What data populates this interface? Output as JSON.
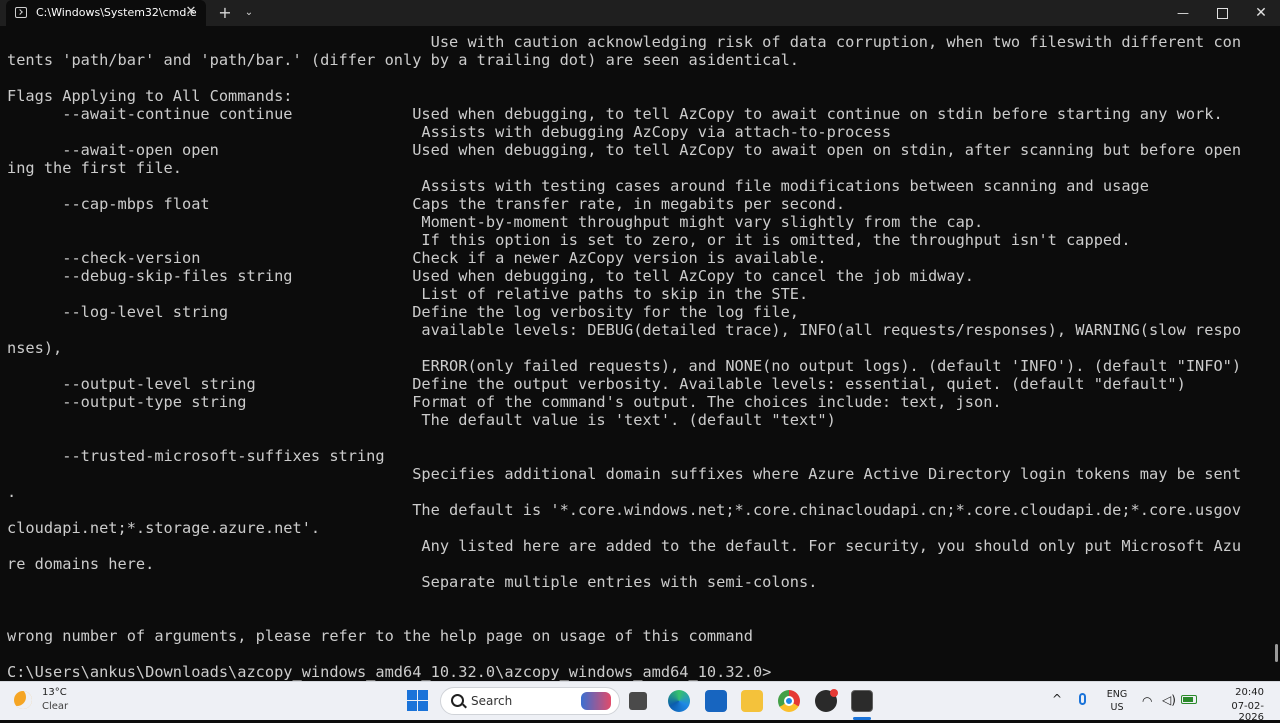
{
  "window": {
    "tab_title": "C:\\Windows\\System32\\cmd.e",
    "tab_close_glyph": "✕",
    "new_tab_glyph": "+",
    "dropdown_glyph": "⌄",
    "minimize_glyph": "—",
    "close_glyph": "✕"
  },
  "console": {
    "text": "                                              Use with caution acknowledging risk of data corruption, when two fileswith different con\ntents 'path/bar' and 'path/bar.' (differ only by a trailing dot) are seen asidentical.\n\nFlags Applying to All Commands:\n      --await-continue continue             Used when debugging, to tell AzCopy to await continue on stdin before starting any work.\n                                             Assists with debugging AzCopy via attach-to-process\n      --await-open open                     Used when debugging, to tell AzCopy to await open on stdin, after scanning but before open\ning the first file.\n                                             Assists with testing cases around file modifications between scanning and usage\n      --cap-mbps float                      Caps the transfer rate, in megabits per second.\n                                             Moment-by-moment throughput might vary slightly from the cap.\n                                             If this option is set to zero, or it is omitted, the throughput isn't capped.\n      --check-version                       Check if a newer AzCopy version is available.\n      --debug-skip-files string             Used when debugging, to tell AzCopy to cancel the job midway.\n                                             List of relative paths to skip in the STE.\n      --log-level string                    Define the log verbosity for the log file,\n                                             available levels: DEBUG(detailed trace), INFO(all requests/responses), WARNING(slow respo\nnses),\n                                             ERROR(only failed requests), and NONE(no output logs). (default 'INFO'). (default \"INFO\")\n      --output-level string                 Define the output verbosity. Available levels: essential, quiet. (default \"default\")\n      --output-type string                  Format of the command's output. The choices include: text, json.\n                                             The default value is 'text'. (default \"text\")\n\n      --trusted-microsoft-suffixes string\n                                            Specifies additional domain suffixes where Azure Active Directory login tokens may be sent\n.\n                                            The default is '*.core.windows.net;*.core.chinacloudapi.cn;*.core.cloudapi.de;*.core.usgov\ncloudapi.net;*.storage.azure.net'.\n                                             Any listed here are added to the default. For security, you should only put Microsoft Azu\nre domains here.\n                                             Separate multiple entries with semi-colons.\n\n\nwrong number of arguments, please refer to the help page on usage of this command\n\nC:\\Users\\ankus\\Downloads\\azcopy_windows_amd64_10.32.0\\azcopy_windows_amd64_10.32.0>"
  },
  "taskbar": {
    "weather_temp": "13°C",
    "weather_condition": "Clear",
    "search_label": "Search",
    "tray_chevron": "^",
    "lang_line1": "ENG",
    "lang_line2": "US",
    "wifi_glyph": "◠",
    "volume_glyph": "◁)",
    "time": "20:40",
    "date": "07-02-2026"
  },
  "icons": {
    "tab": "terminal-icon",
    "weather": "moon-icon",
    "start": "windows-logo-icon",
    "search": "search-icon",
    "task_view": "task-view-icon",
    "edge": "edge-icon",
    "store": "store-icon",
    "explorer": "folder-icon",
    "chrome": "chrome-icon",
    "app": "app-icon",
    "terminal": "terminal-icon",
    "mic": "microphone-icon",
    "wifi": "wifi-icon",
    "volume": "volume-icon",
    "battery": "battery-icon"
  },
  "colors": {
    "console_bg": "#0c0c0c",
    "console_fg": "#cccccc",
    "titlebar_bg": "#1f1f1f",
    "taskbar_bg": "#eef0f5",
    "accent": "#1a73d9"
  }
}
